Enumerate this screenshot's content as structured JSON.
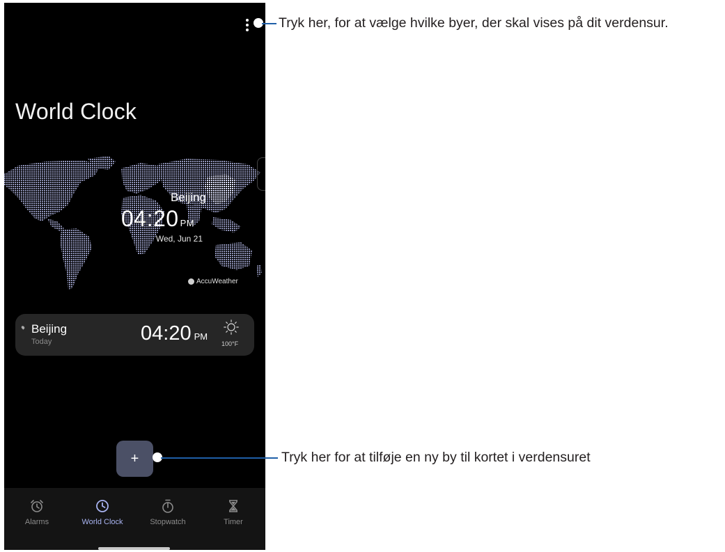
{
  "app": {
    "title": "World Clock"
  },
  "map": {
    "city": "Beijing",
    "time": "04:20",
    "ampm": "PM",
    "date": "Wed, Jun 21",
    "attribution": "AccuWeather"
  },
  "city_list": [
    {
      "city": "Beijing",
      "day": "Today",
      "time": "04:20",
      "ampm": "PM",
      "weather_icon": "sun-icon",
      "temperature": "100°F"
    }
  ],
  "add_button": {
    "label": "+"
  },
  "nav": [
    {
      "label": "Alarms",
      "icon": "alarm-clock-icon",
      "active": false
    },
    {
      "label": "World Clock",
      "icon": "clock-icon",
      "active": true
    },
    {
      "label": "Stopwatch",
      "icon": "stopwatch-icon",
      "active": false
    },
    {
      "label": "Timer",
      "icon": "hourglass-icon",
      "active": false
    }
  ],
  "callouts": {
    "menu": "Tryk her, for at vælge hvilke byer, der skal vises på dit verdensur.",
    "add": "Tryk her for at tilføje en ny by til kortet i verdensuret"
  },
  "colors": {
    "background": "#000000",
    "accent": "#a9b4f2",
    "add_button": "#4b5066",
    "callout_line": "#1f5fa8"
  }
}
